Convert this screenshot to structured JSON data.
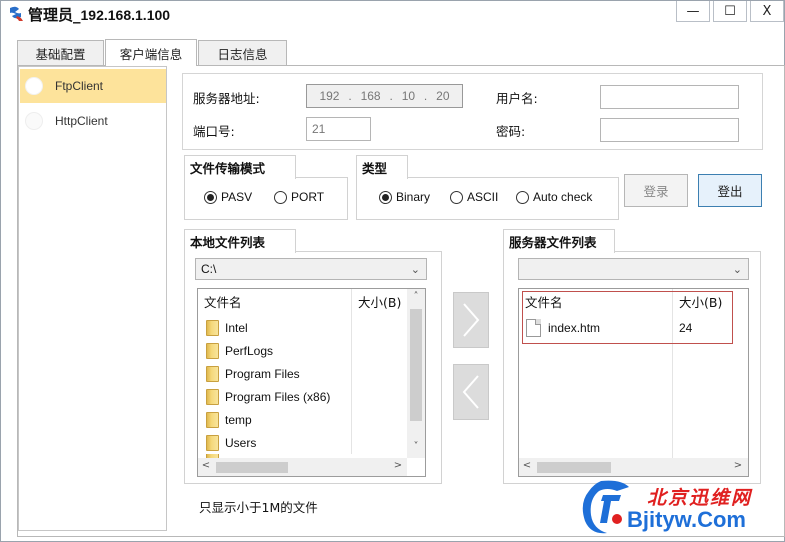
{
  "window": {
    "title_prefix": "管理员_",
    "title_ip": "192.168.1.100",
    "controls": {
      "minimize": "—",
      "maximize": "☐",
      "close": "X"
    }
  },
  "tabs": [
    {
      "label": "基础配置",
      "active": false
    },
    {
      "label": "客户端信息",
      "active": true
    },
    {
      "label": "日志信息",
      "active": false
    }
  ],
  "sidebar": {
    "items": [
      {
        "label": "FtpClient",
        "selected": true
      },
      {
        "label": "HttpClient",
        "selected": false
      }
    ]
  },
  "connection": {
    "server_label": "服务器地址:",
    "server_ip": [
      "192",
      "168",
      "10",
      "20"
    ],
    "port_label": "端口号:",
    "port_value": "21",
    "user_label": "用户名:",
    "user_value": "",
    "password_label": "密码:",
    "password_value": ""
  },
  "transfer_mode": {
    "title": "文件传输模式",
    "options": [
      {
        "label": "PASV",
        "checked": true
      },
      {
        "label": "PORT",
        "checked": false
      }
    ]
  },
  "type": {
    "title": "类型",
    "options": [
      {
        "label": "Binary",
        "checked": true
      },
      {
        "label": "ASCII",
        "checked": false
      },
      {
        "label": "Auto check",
        "checked": false
      }
    ]
  },
  "buttons": {
    "login": "登录",
    "logout": "登出"
  },
  "local": {
    "title": "本地文件列表",
    "drive": "C:\\",
    "col_name": "文件名",
    "col_size": "大小(B)",
    "files": [
      "Intel",
      "PerfLogs",
      "Program Files",
      "Program Files (x86)",
      "temp",
      "Users"
    ]
  },
  "server": {
    "title": "服务器文件列表",
    "path": "",
    "col_name": "文件名",
    "col_size": "大小(B)",
    "files": [
      {
        "name": "index.htm",
        "size": "24"
      }
    ]
  },
  "note": "只显示小于1M的文件",
  "watermark": {
    "cn": "北京迅维网",
    "en": "Bjityw.Com"
  },
  "colors": {
    "sidebar_selected": "#fde39b",
    "primary_border": "#3c7fb1",
    "highlight_box": "#c0504d",
    "watermark_red": "#e02020",
    "watermark_blue": "#1e6fd8"
  }
}
